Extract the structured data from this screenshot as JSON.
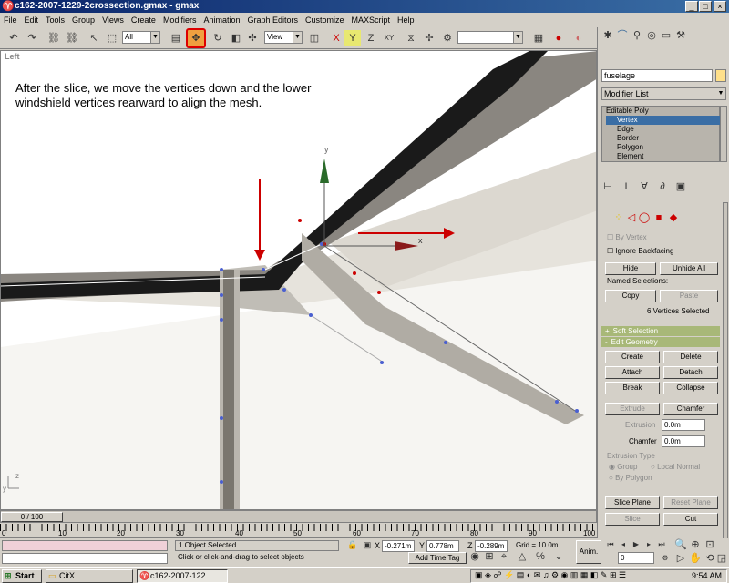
{
  "window": {
    "title": "c162-2007-1229-2crossection.gmax - gmax",
    "min": "_",
    "max": "□",
    "close": "×"
  },
  "menu": [
    "File",
    "Edit",
    "Tools",
    "Group",
    "Views",
    "Create",
    "Modifiers",
    "Animation",
    "Graph Editors",
    "Customize",
    "MAXScript",
    "Help"
  ],
  "toolbar": {
    "filter_value": "All",
    "coord_value": "View"
  },
  "viewport": {
    "label": "Left",
    "annotation": "After the slice, we move the vertices down and the lower windshield vertices rearward to align the mesh.",
    "gizmo_y": "y",
    "gizmo_x": "x",
    "axis_z": "z",
    "axis_y": "y"
  },
  "command_panel": {
    "object_name": "fuselage",
    "modifier_list": "Modifier List",
    "stack": {
      "root": "Editable Poly",
      "items": [
        "Vertex",
        "Edge",
        "Border",
        "Polygon",
        "Element"
      ],
      "selected_index": 0
    },
    "selection": {
      "by_vertex": "By Vertex",
      "ignore_backfacing": "Ignore Backfacing",
      "hide": "Hide",
      "unhide_all": "Unhide All",
      "named_selections": "Named Selections:",
      "copy": "Copy",
      "paste": "Paste",
      "status": "6 Vertices Selected"
    },
    "soft_selection": "Soft Selection",
    "edit_geometry": {
      "title": "Edit Geometry",
      "create": "Create",
      "delete": "Delete",
      "attach": "Attach",
      "detach": "Detach",
      "break": "Break",
      "collapse": "Collapse",
      "extrude": "Extrude",
      "chamfer": "Chamfer",
      "extrusion_label": "Extrusion",
      "extrusion_value": "0.0m",
      "chamfer_label": "Chamfer",
      "chamfer_value": "0.0m",
      "extrusion_type": "Extrusion Type",
      "group": "Group",
      "local_normal": "Local Normal",
      "by_polygon": "By Polygon",
      "slice_plane": "Slice Plane",
      "reset_plane": "Reset Plane",
      "slice": "Slice",
      "cut": "Cut"
    }
  },
  "timeline": {
    "slider_label": "0 / 100",
    "ticks": [
      "0",
      "10",
      "20",
      "30",
      "40",
      "50",
      "60",
      "70",
      "80",
      "90",
      "100"
    ]
  },
  "status": {
    "selected": "1 Object Selected",
    "prompt": "Click or click-and-drag to select objects",
    "x_label": "X",
    "x_value": "-0.271m",
    "y_label": "Y",
    "y_value": "0.778m",
    "z_label": "Z",
    "z_value": "-0.289m",
    "grid": "Grid = 10.0m",
    "add_time_tag": "Add Time Tag",
    "anim": "Anim.",
    "frame": "0"
  },
  "taskbar": {
    "start": "Start",
    "tasks": [
      "CitX",
      "c162-2007-122..."
    ],
    "clock": "9:54 AM"
  },
  "colors": {
    "titlebar": "#0a246a",
    "panel": "#d4d0c8",
    "selected_vertex": "#4a5fd0",
    "annotation_arrow": "#cc0000"
  }
}
